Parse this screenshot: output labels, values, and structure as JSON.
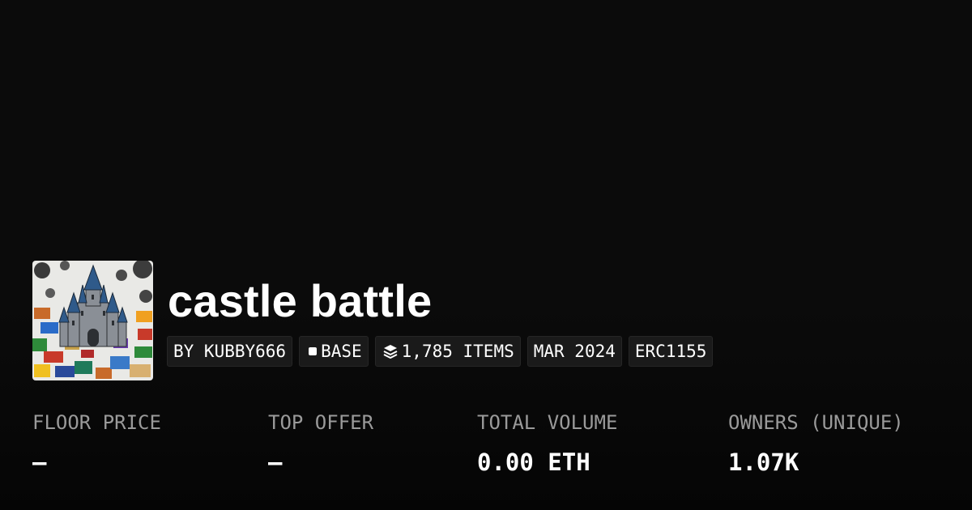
{
  "collection": {
    "title": "castle battle",
    "thumbnail_icon": "castle-artwork"
  },
  "tags": {
    "creator": "BY KUBBY666",
    "chain": "BASE",
    "chain_icon": "square-icon",
    "items": "1,785 ITEMS",
    "items_icon": "layers-icon",
    "date": "MAR 2024",
    "standard": "ERC1155"
  },
  "stats": [
    {
      "label": "FLOOR PRICE",
      "value": "–"
    },
    {
      "label": "TOP OFFER",
      "value": "–"
    },
    {
      "label": "TOTAL VOLUME",
      "value": "0.00 ETH"
    },
    {
      "label": "OWNERS (UNIQUE)",
      "value": "1.07K"
    }
  ],
  "colors": {
    "background": "#0b0b0b",
    "tag_background": "#1a1a1a",
    "label": "#9a9a9a",
    "value": "#ffffff"
  }
}
